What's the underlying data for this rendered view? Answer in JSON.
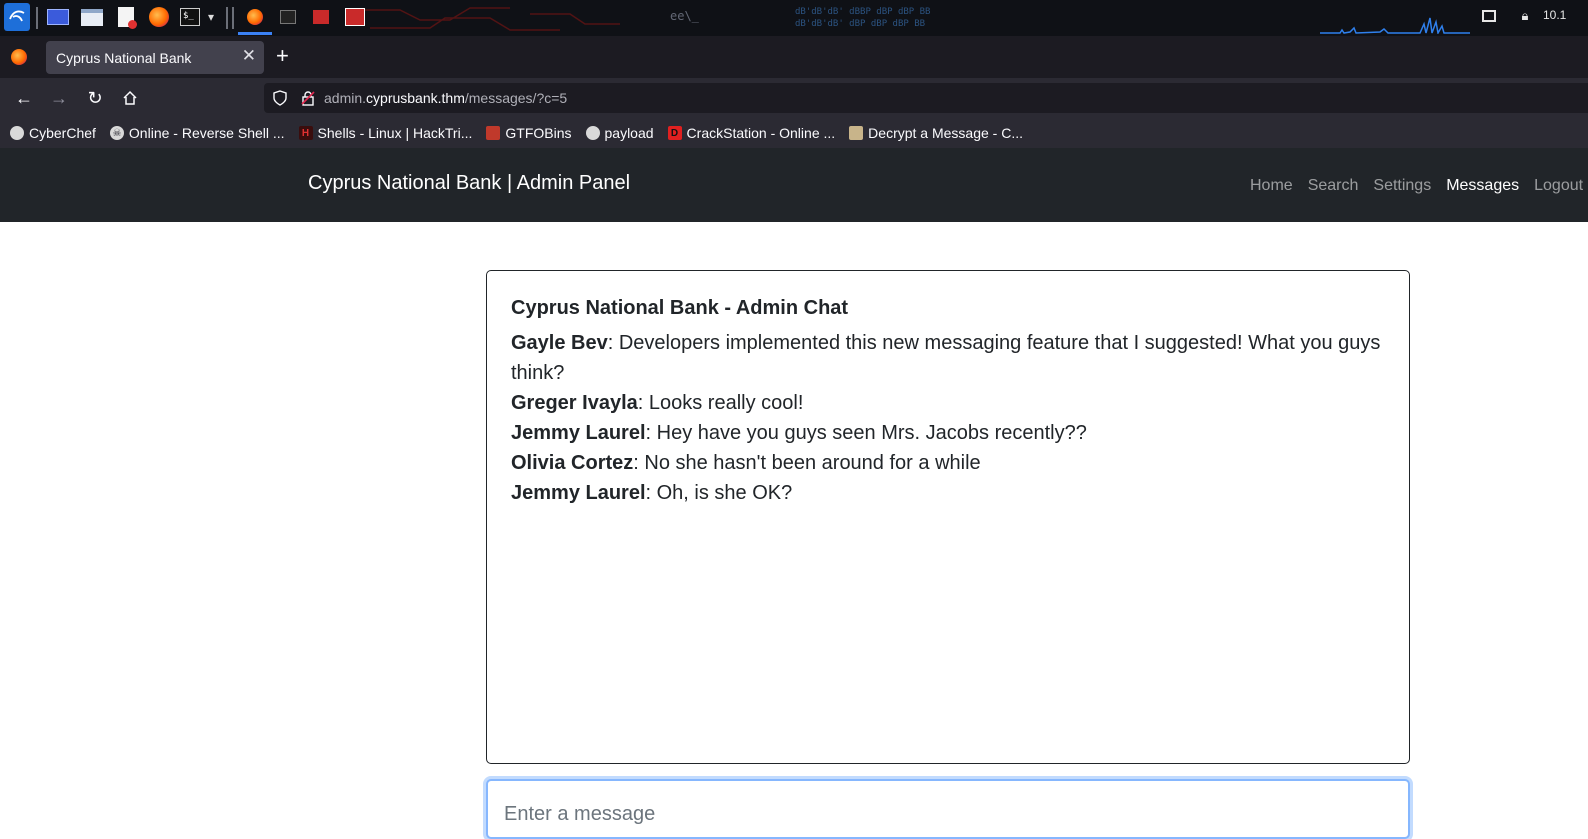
{
  "taskbar": {
    "clock": "10.1",
    "art_text_1": "ee\\_",
    "art_text_2": "dB'dB'dB' dBBP    dBP    dBP BB",
    "art_text_3": "dB'dB'dB' dBP     dBP    dBP BB"
  },
  "browser": {
    "tab_title": "Cyprus National Bank",
    "url_prefix": "admin.",
    "url_host": "cyprusbank.thm",
    "url_path": "/messages/?c=5",
    "bookmarks": [
      {
        "label": "CyberChef",
        "color": "#d9d9d9"
      },
      {
        "label": "Online - Reverse Shell ...",
        "color": "#d9d9d9"
      },
      {
        "label": "Shells - Linux | HackTri...",
        "color": "#c0392b"
      },
      {
        "label": "GTFOBins",
        "color": "#c0392b"
      },
      {
        "label": "payload",
        "color": "#d9d9d9"
      },
      {
        "label": "CrackStation - Online ...",
        "color": "#e02020"
      },
      {
        "label": "Decrypt a Message - C...",
        "color": "#c8b48a"
      }
    ]
  },
  "site": {
    "brand": "Cyprus National Bank | Admin Panel",
    "nav": [
      "Home",
      "Search",
      "Settings",
      "Messages",
      "Logout"
    ],
    "active_nav": "Messages"
  },
  "chat": {
    "title": "Cyprus National Bank - Admin Chat",
    "messages": [
      {
        "author": "Gayle Bev",
        "text": ": Developers implemented this new messaging feature that I suggested! What you guys think?"
      },
      {
        "author": "Greger Ivayla",
        "text": ": Looks really cool!"
      },
      {
        "author": "Jemmy Laurel",
        "text": ": Hey have you guys seen Mrs. Jacobs recently??"
      },
      {
        "author": "Olivia Cortez",
        "text": ": No she hasn't been around for a while"
      },
      {
        "author": "Jemmy Laurel",
        "text": ": Oh, is she OK?"
      }
    ],
    "input_placeholder": "Enter a message"
  }
}
